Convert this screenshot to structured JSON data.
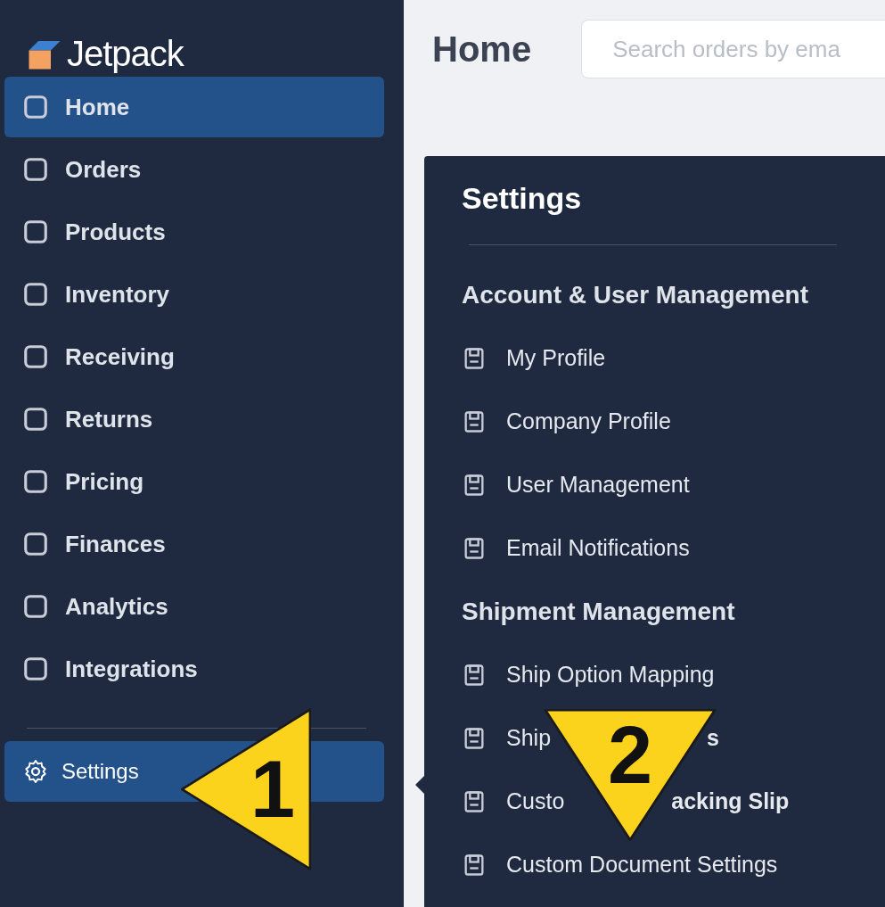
{
  "logo": {
    "text": "Jetpack"
  },
  "sidebar": {
    "items": [
      {
        "label": "Home",
        "selected": true
      },
      {
        "label": "Orders",
        "selected": false
      },
      {
        "label": "Products",
        "selected": false
      },
      {
        "label": "Inventory",
        "selected": false
      },
      {
        "label": "Receiving",
        "selected": false
      },
      {
        "label": "Returns",
        "selected": false
      },
      {
        "label": "Pricing",
        "selected": false
      },
      {
        "label": "Finances",
        "selected": false
      },
      {
        "label": "Analytics",
        "selected": false
      },
      {
        "label": "Integrations",
        "selected": false
      }
    ],
    "footer_item": {
      "label": "Settings",
      "selected": true
    }
  },
  "header": {
    "title": "Home",
    "search": {
      "placeholder": "Search orders by ema"
    }
  },
  "settings_menu": {
    "title": "Settings",
    "entries": [
      {
        "kind": "heading",
        "label": "Account & User Management"
      },
      {
        "kind": "item",
        "label": "My Profile"
      },
      {
        "kind": "item",
        "label": "Company Profile"
      },
      {
        "kind": "item",
        "label": "User Management"
      },
      {
        "kind": "item",
        "label": "Email Notifications"
      },
      {
        "kind": "heading",
        "label": "Shipment Management"
      },
      {
        "kind": "item",
        "label": "Ship Option Mapping"
      },
      {
        "kind": "item",
        "label": "Ship",
        "tail": "s"
      },
      {
        "kind": "item",
        "label": "Custo",
        "tail": "acking Slip"
      },
      {
        "kind": "item",
        "label": "Custom Document Settings"
      }
    ]
  },
  "callouts": [
    {
      "kind": "left",
      "number": "1"
    },
    {
      "kind": "down",
      "number": "2"
    }
  ]
}
